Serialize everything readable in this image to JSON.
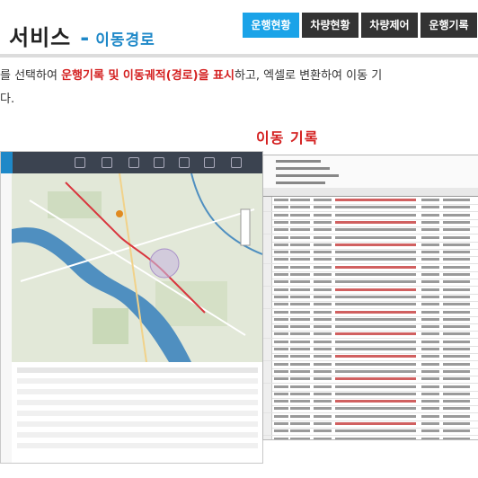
{
  "header": {
    "title": "서비스",
    "separator": "-",
    "subtitle": "이동경로",
    "tabs": [
      {
        "label": "운행현황",
        "active": true
      },
      {
        "label": "차량현황",
        "active": false
      },
      {
        "label": "차량제어",
        "active": false
      },
      {
        "label": "운행기록",
        "active": false
      }
    ]
  },
  "description": {
    "line1_a": "를  선택하여 ",
    "line1_highlight": "운행기록 및 이동궤적(경로)을 표시",
    "line1_b": "하고, 엑셀로 변환하여 이동 기",
    "line2": "다."
  },
  "log_section": {
    "title": "이동 기록"
  },
  "colors": {
    "accent": "#1aa3e8",
    "tab_dark": "#333333",
    "highlight": "#d42020",
    "subtitle": "#1e88c8"
  }
}
